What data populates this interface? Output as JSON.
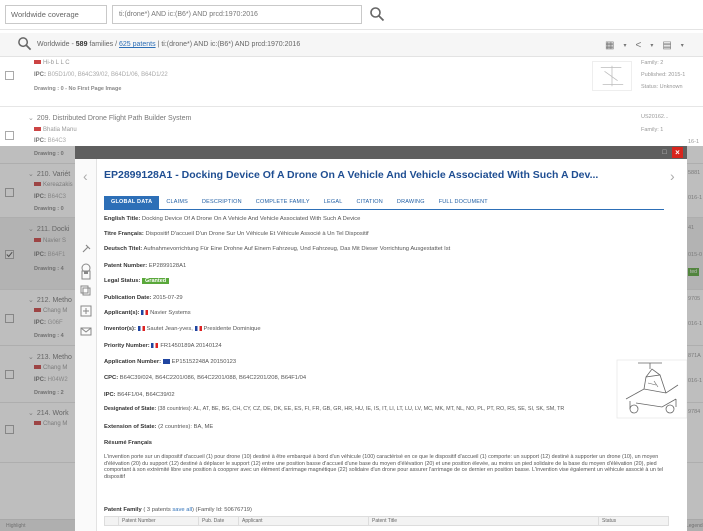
{
  "topbar": {
    "scope": "Worldwide coverage",
    "query": "ti:(drone*) AND ic:(B6*) AND prcd:1970:2016"
  },
  "results_header": {
    "scope": "Worldwide -",
    "families": "589",
    "families_label": "families /",
    "patents_link": "625 patents",
    "query": "ti:(drone*) AND ic:(B6*) AND prcd:1970:2016"
  },
  "rows": [
    {
      "title": "",
      "owner": "Hi-b L L C",
      "ipc": "B05D1/00, B64C39/02, B64D1/06, B64D1/22",
      "drawing": "Drawing : 0 - No First Page Image",
      "right1": "Family: 2",
      "right2": "Published: 2015-1",
      "right3": "Status: Unknown"
    },
    {
      "title": "209. Distributed Drone Flight Path Builder System",
      "owner": "Bhatia Manu",
      "ipc": "B64C3",
      "drawing": "Drawing : 0",
      "right1": "US20162...",
      "right2": "Family: 1",
      "right3": "16-1"
    },
    {
      "title": "210. Variét",
      "owner": "Kereazakis",
      "ipc": "B64C3",
      "drawing": "Drawing : 0",
      "right1": "5881",
      "right2": "016-1"
    },
    {
      "title": "211. Docki",
      "owner": "Navier S",
      "ipc": "B64F1",
      "drawing": "Drawing : 4",
      "right1": "41",
      "right2": "015-0",
      "right3": "ted"
    },
    {
      "title": "212. Metho",
      "owner": "Chang M",
      "ipc": "G06F",
      "drawing": "Drawing : 4",
      "right1": "9705",
      "right2": "016-1"
    },
    {
      "title": "213. Metho",
      "owner": "Chang M",
      "ipc": "H04W2",
      "drawing": "Drawing : 2",
      "right1": "871A",
      "right2": "016-1"
    },
    {
      "title": "214. Work",
      "owner": "Chang M",
      "ipc": "",
      "drawing": "",
      "right1": "9784",
      "right2": ""
    }
  ],
  "bottom_strip": {
    "left": "Highlight",
    "right": "Legend"
  },
  "modal": {
    "title": "EP2899128A1 - Docking Device Of A Drone On A Vehicle And Vehicle Associated With Such A Dev...",
    "tabs": [
      "GLOBAL DATA",
      "CLAIMS",
      "DESCRIPTION",
      "COMPLETE FAMILY",
      "LEGAL",
      "CITATION",
      "DRAWING",
      "FULL DOCUMENT"
    ],
    "fields": {
      "english_title_label": "English Title:",
      "english_title": "Docking Device Of A Drone On A Vehicle And Vehicle Associated With Such A Device",
      "french_title_label": "Titre Français:",
      "french_title": "Dispositif D'accueil D'un Drone Sur Un Véhicule Et Véhicule Associé à Un Tel Dispositif",
      "german_title_label": "Deutsch Titel:",
      "german_title": "Aufnahmevorrichtung Für Eine Drohne Auf Einem Fahrzeug, Und Fahrzeug, Das Mit Dieser Vorrichtung Ausgestattet Ist",
      "patent_number_label": "Patent Number:",
      "patent_number": "EP2899128A1",
      "legal_status_label": "Legal Status:",
      "legal_status": "Granted",
      "publication_date_label": "Publication Date:",
      "publication_date": "2015-07-29",
      "applicant_label": "Applicant(s):",
      "applicant": "Navier Systems",
      "inventor_label": "Inventor(s):",
      "inventor_1": "Sautet Jean-yves,",
      "inventor_2": "Presidente Dominique",
      "priority_label": "Priority Number:",
      "priority": "FR1450189A 20140124",
      "application_label": "Application Number:",
      "application": "EP15152248A 20150123",
      "cpc_label": "CPC:",
      "cpc": "B64C39/024, B64C2201/086, B64C2201/088, B64C2201/208, B64F1/04",
      "ipc_label": "IPC:",
      "ipc": "B64F1/04, B64C39/02",
      "designated_label": "Designated of State:",
      "designated": "(38 countries): AL, AT, BE, BG, CH, CY, CZ, DE, DK, EE, ES, FI, FR, GB, GR, HR, HU, IE, IS, IT, LI, LT, LU, LV, MC, MK, MT, NL, NO, PL, PT, RO, RS, SE, SI, SK, SM, TR",
      "extension_label": "Extension of State:",
      "extension": "(2 countries): BA, ME",
      "abstract_label": "Résumé Français",
      "abstract": "L'invention porte sur un dispositif d'accueil (1) pour drone (10) destiné à être embarqué à bord d'un véhicule (100) caractérisé en ce que le dispositif d'accueil (1) comporte: un support (12) destiné à supporter un drone (10), un moyen d'élévation (20) du support (12) destiné à déplacer le support (12) entre une position basse d'accueil d'une base du moyen d'élévation (20) et une position élevée, au moins un pied solidaire de la base du moyen d'élévation (20), pied comportant à son extrémité libre une position à coopprer avec un élément d'arrimage magnétique (22) solidaire d'un drone pour assurer l'arrimage de ce dernier en position basse. L'invention vise également un véhicule associé à un tel dispositif",
      "family_label": "Patent Family",
      "family_count": "( 3 patents",
      "family_save": "save all",
      "family_id": ") (Family Id: 50676719)"
    },
    "family_table_headers": [
      "Patent Number",
      "Pub. Date",
      "Applicant",
      "Patent Title",
      "Status"
    ]
  },
  "colors": {
    "title_blue": "#1f4e92",
    "tab_active": "#2d6fb7",
    "granted_green": "#5aa83b",
    "close_red": "#d9251d"
  }
}
